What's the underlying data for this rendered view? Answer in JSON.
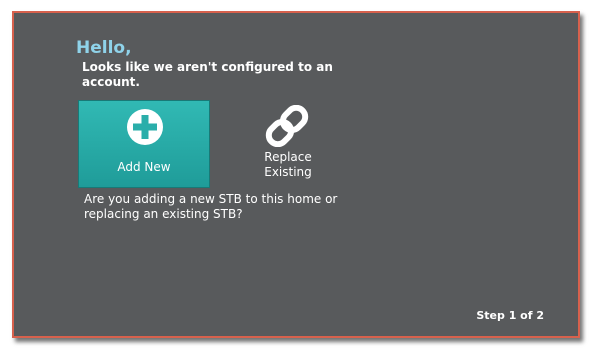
{
  "greeting": "Hello,",
  "subtitle": "Looks like we aren't configured to an account.",
  "options": {
    "add_new": {
      "label": "Add New",
      "icon": "plus-circle-icon"
    },
    "replace_existing": {
      "label": "Replace\nExisting",
      "icon": "link-icon"
    }
  },
  "question": "Are you adding a new STB to this home or replacing an existing STB?",
  "step": "Step 1 of 2",
  "colors": {
    "background": "#585a5c",
    "frame_border": "#d7614d",
    "greeting_text": "#8fd3ea",
    "selected_tile": "#2cb2ae",
    "text": "#ffffff"
  }
}
